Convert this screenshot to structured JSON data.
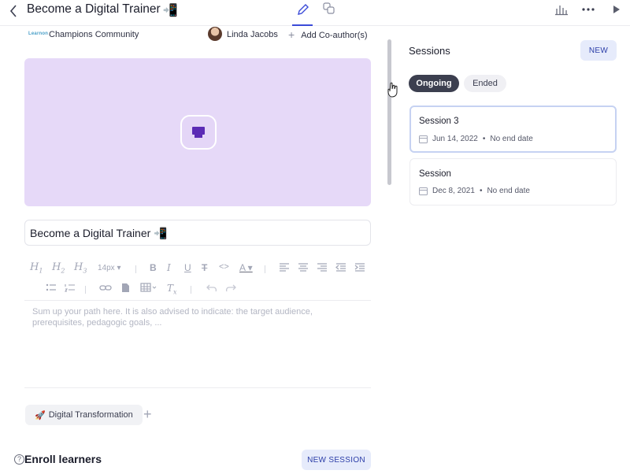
{
  "header": {
    "title": "Become a Digital Trainer",
    "title_emoji": "📲"
  },
  "meta": {
    "community_logo": "Learnon",
    "community": "Champions Community",
    "author": "Linda Jacobs",
    "add_coauthor": "Add Co-author(s)"
  },
  "editor": {
    "title_value": "Become a Digital Trainer 📲",
    "font_size": "14px",
    "summary_placeholder": "Sum up your path here. It is also advised to indicate: the target audience, prerequisites, pedagogic goals, ..."
  },
  "tags": [
    {
      "emoji": "🚀",
      "label": "Digital Transformation"
    }
  ],
  "enroll": {
    "title": "Enroll learners",
    "button": "NEW SESSION"
  },
  "sessions": {
    "title": "Sessions",
    "new_button": "NEW",
    "filters": [
      "Ongoing",
      "Ended"
    ],
    "items": [
      {
        "name": "Session 3",
        "date": "Jun 14, 2022",
        "end": "No end date"
      },
      {
        "name": "Session",
        "date": "Dec 8, 2021",
        "end": "No end date"
      }
    ]
  },
  "colors": {
    "accent": "#3b4bd8",
    "cover_bg": "#e6d9f8",
    "chip_active": "#3c3f4f",
    "button_bg": "#e6ebfb"
  }
}
